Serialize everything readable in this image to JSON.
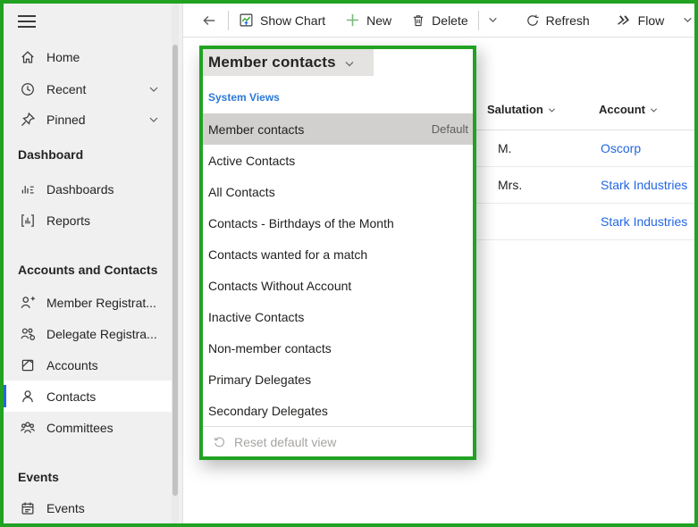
{
  "colors": {
    "annotation_green": "#22a222",
    "accent_blue": "#2266e3",
    "link_blue": "#2266e3",
    "system_views_blue": "#2b79d7",
    "sidebar_bg": "#f0f0f0",
    "selected_row_gray": "#d2d0ce",
    "title_bar_gray": "#e4e3e1"
  },
  "toolbar": {
    "show_chart": "Show Chart",
    "new": "New",
    "delete": "Delete",
    "refresh": "Refresh",
    "flow": "Flow"
  },
  "sidebar": {
    "top_items": [
      {
        "label": "Home",
        "icon": "home-icon"
      },
      {
        "label": "Recent",
        "icon": "clock-icon",
        "collapsible": true
      },
      {
        "label": "Pinned",
        "icon": "pin-icon",
        "collapsible": true
      }
    ],
    "sections": [
      {
        "title": "Dashboard",
        "items": [
          {
            "label": "Dashboards",
            "icon": "dashboard-icon"
          },
          {
            "label": "Reports",
            "icon": "report-icon"
          }
        ]
      },
      {
        "title": "Accounts and Contacts",
        "items": [
          {
            "label": "Member Registrat...",
            "icon": "person-add-icon"
          },
          {
            "label": "Delegate Registra...",
            "icon": "people-settings-icon"
          },
          {
            "label": "Accounts",
            "icon": "accounts-icon"
          },
          {
            "label": "Contacts",
            "icon": "person-icon",
            "selected": true
          },
          {
            "label": "Committees",
            "icon": "people-icon"
          }
        ]
      },
      {
        "title": "Events",
        "items": [
          {
            "label": "Events",
            "icon": "calendar-icon"
          }
        ]
      }
    ]
  },
  "view_selector": {
    "title": "Member contacts",
    "group_label": "System Views",
    "default_badge": "Default",
    "views": [
      "Member contacts",
      "Active Contacts",
      "All Contacts",
      "Contacts - Birthdays of the Month",
      "Contacts wanted for a match",
      "Contacts Without Account",
      "Inactive Contacts",
      "Non-member contacts",
      "Primary Delegates",
      "Secondary Delegates"
    ],
    "selected_view": "Member contacts",
    "reset_label": "Reset default view"
  },
  "grid": {
    "columns": [
      "Salutation",
      "Account"
    ],
    "rows": [
      {
        "salutation": "M.",
        "account": "Oscorp"
      },
      {
        "salutation": "Mrs.",
        "account": "Stark Industries"
      },
      {
        "salutation": "",
        "account": "Stark Industries"
      }
    ]
  }
}
